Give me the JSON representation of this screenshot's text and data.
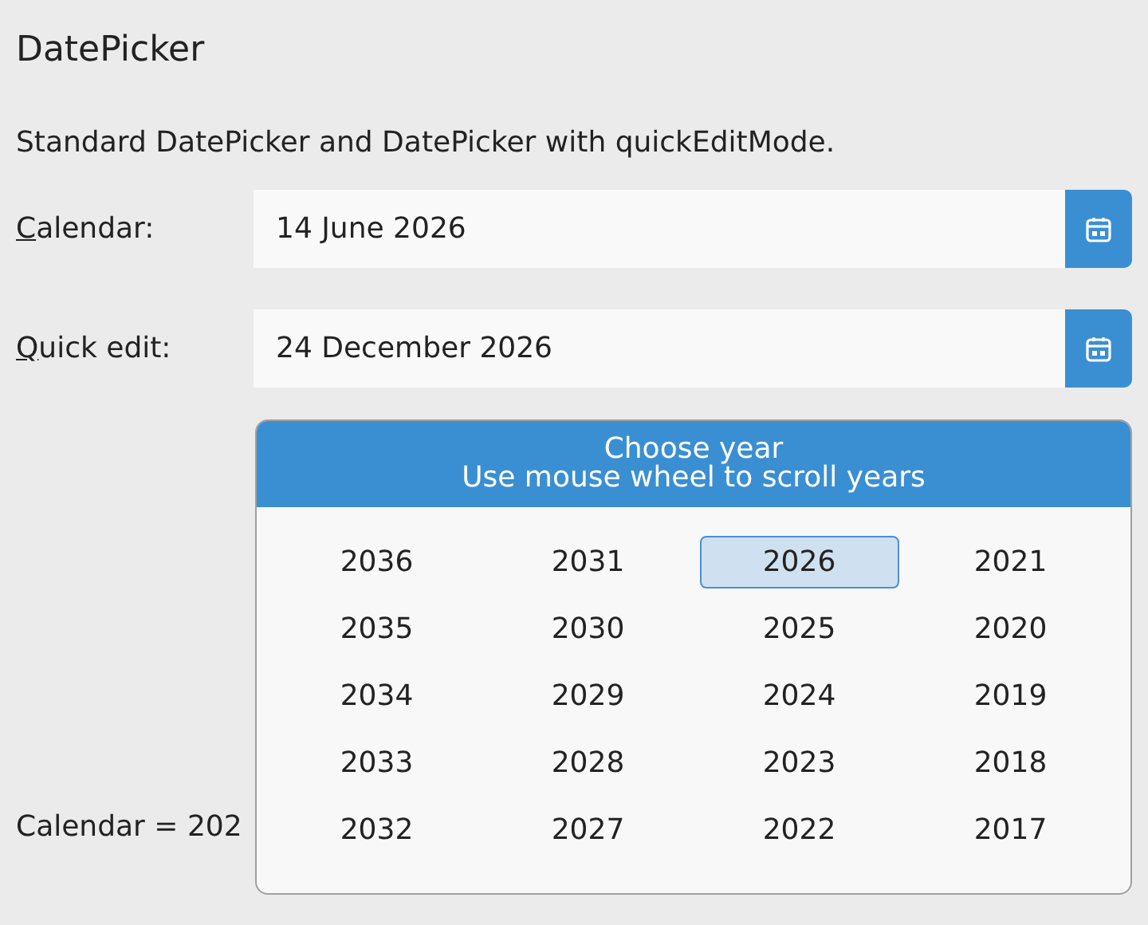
{
  "title": "DatePicker",
  "description": "Standard DatePicker and DatePicker with quickEditMode.",
  "fields": [
    {
      "label": "Calendar:",
      "value": "14 June 2026"
    },
    {
      "label": "Quick edit:",
      "value": "24 December 2026"
    }
  ],
  "result": "Calendar = 202",
  "year_popup": {
    "header": [
      "Choose year",
      "Use mouse wheel to scroll years"
    ],
    "years": [
      {
        "label": "2036",
        "selected": false
      },
      {
        "label": "2031",
        "selected": false
      },
      {
        "label": "2026",
        "selected": true
      },
      {
        "label": "2021",
        "selected": false
      },
      {
        "label": "2035",
        "selected": false
      },
      {
        "label": "2030",
        "selected": false
      },
      {
        "label": "2025",
        "selected": false
      },
      {
        "label": "2020",
        "selected": false
      },
      {
        "label": "2034",
        "selected": false
      },
      {
        "label": "2029",
        "selected": false
      },
      {
        "label": "2024",
        "selected": false
      },
      {
        "label": "2019",
        "selected": false
      },
      {
        "label": "2033",
        "selected": false
      },
      {
        "label": "2028",
        "selected": false
      },
      {
        "label": "2023",
        "selected": false
      },
      {
        "label": "2018",
        "selected": false
      },
      {
        "label": "2032",
        "selected": false
      },
      {
        "label": "2027",
        "selected": false
      },
      {
        "label": "2022",
        "selected": false
      },
      {
        "label": "2017",
        "selected": false
      }
    ]
  }
}
